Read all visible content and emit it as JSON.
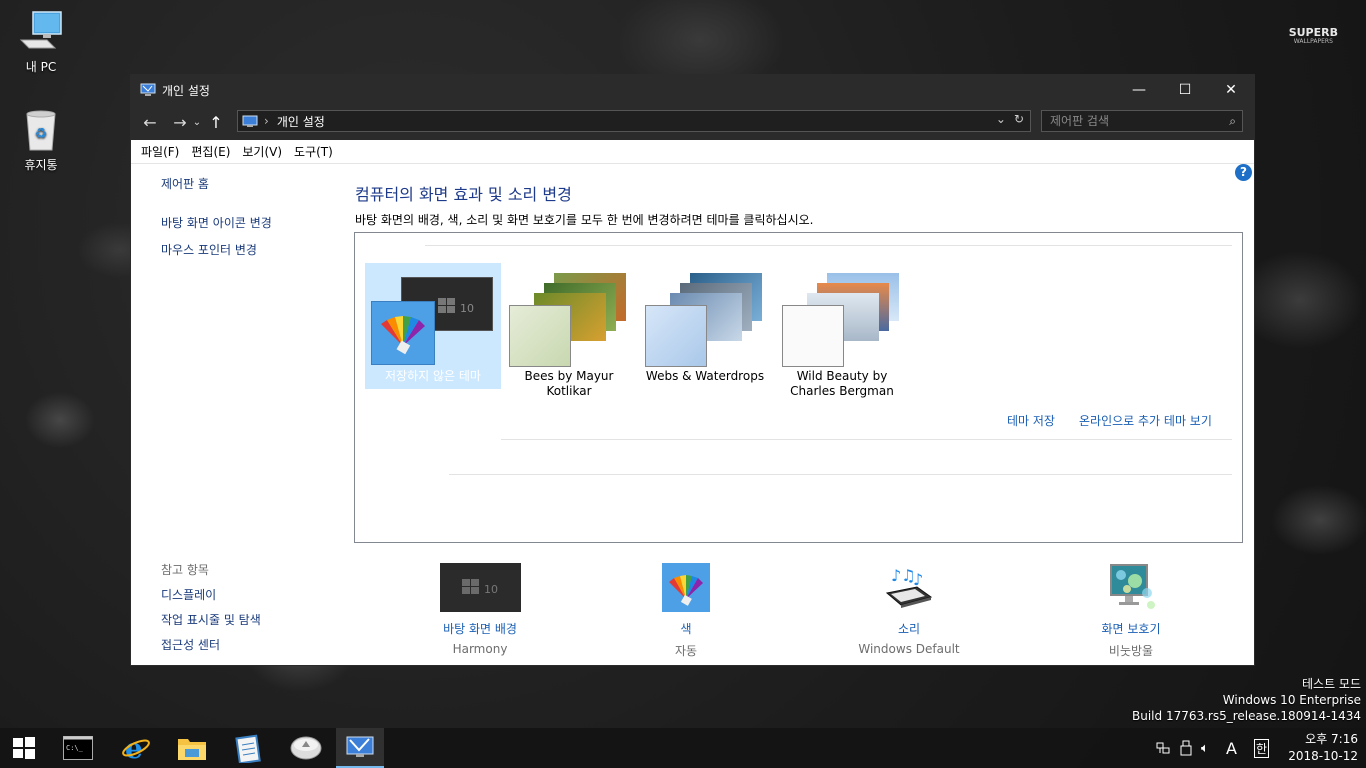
{
  "desktop": {
    "icons": [
      {
        "label": "내 PC"
      },
      {
        "label": "휴지통"
      }
    ],
    "watermark": {
      "line1": "SUPERB",
      "line2": "WALLPAPERS"
    }
  },
  "window": {
    "title": "개인 설정",
    "controls": {
      "minimize": "—",
      "maximize": "☐",
      "close": "✕"
    },
    "address": {
      "crumb": "개인 설정",
      "separator": "›"
    },
    "search_placeholder": "제어판 검색",
    "menu": [
      "파일(F)",
      "편집(E)",
      "보기(V)",
      "도구(T)"
    ],
    "left_pane": {
      "home": "제어판 홈",
      "links": [
        "바탕 화면 아이콘 변경",
        "마우스 포인터 변경"
      ]
    },
    "see_also": {
      "header": "참고 항목",
      "links": [
        "디스플레이",
        "작업 표시줄 및 탐색",
        "접근성 센터"
      ]
    },
    "main": {
      "title": "컴퓨터의 화면 효과 및 소리 변경",
      "description": "바탕 화면의 배경, 색, 소리 및 화면 보호기를 모두 한 번에 변경하려면 테마를 클릭하십시오.",
      "themes": [
        {
          "name": "저장하지 않은 테마",
          "selected": true
        },
        {
          "name": "Bees by Mayur Kotlikar",
          "selected": false
        },
        {
          "name": "Webs & Waterdrops",
          "selected": false
        },
        {
          "name": "Wild Beauty by Charles Bergman",
          "selected": false
        }
      ],
      "save_theme": "테마 저장",
      "more_online": "온라인으로 추가 테마 보기"
    },
    "bottom": [
      {
        "link": "바탕 화면 배경",
        "value": "Harmony",
        "icon": "desktop-background-icon"
      },
      {
        "link": "색",
        "value": "자동",
        "icon": "color-icon"
      },
      {
        "link": "소리",
        "value": "Windows Default",
        "icon": "sound-icon"
      },
      {
        "link": "화면 보호기",
        "value": "비눗방울",
        "icon": "screensaver-icon"
      }
    ]
  },
  "build_info": {
    "line1": "테스트 모드",
    "line2": "Windows 10 Enterprise",
    "line3": "Build 17763.rs5_release.180914-1434"
  },
  "taskbar": {
    "apps": [
      "start-icon",
      "cmd-icon",
      "ie-icon",
      "explorer-icon",
      "notepad-icon",
      "drive-icon",
      "personalization-icon"
    ],
    "tray": {
      "ime_a": "A",
      "ime_han": "한"
    },
    "clock": {
      "time": "오후 7:16",
      "date": "2018-10-12"
    }
  },
  "colors": {
    "accent": "#1a5fb4",
    "selection": "#cce8ff",
    "titlebar": "#2b2b2b"
  }
}
